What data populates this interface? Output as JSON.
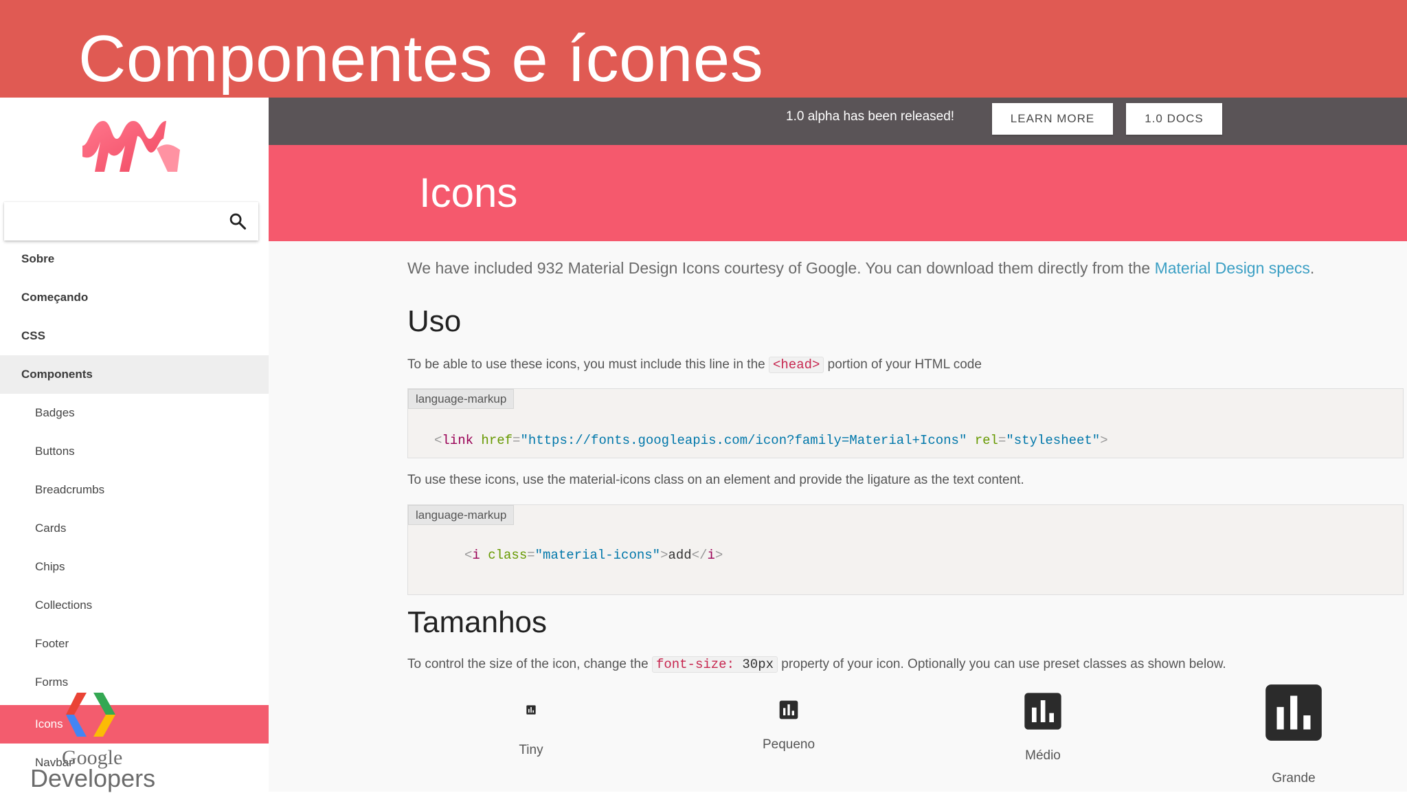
{
  "slide": {
    "title": "Componentes e ícones"
  },
  "sidebar": {
    "logo_icon": "materialize-logo-icon",
    "search": {
      "placeholder": "",
      "icon": "search-icon"
    },
    "items": [
      {
        "label": "Sobre",
        "level": "top"
      },
      {
        "label": "Começando",
        "level": "top"
      },
      {
        "label": "CSS",
        "level": "top"
      },
      {
        "label": "Components",
        "level": "top",
        "expanded": true
      },
      {
        "label": "Badges",
        "level": "sub"
      },
      {
        "label": "Buttons",
        "level": "sub"
      },
      {
        "label": "Breadcrumbs",
        "level": "sub"
      },
      {
        "label": "Cards",
        "level": "sub"
      },
      {
        "label": "Chips",
        "level": "sub"
      },
      {
        "label": "Collections",
        "level": "sub"
      },
      {
        "label": "Footer",
        "level": "sub"
      },
      {
        "label": "Forms",
        "level": "sub"
      },
      {
        "label": "Icons",
        "level": "sub",
        "active": true
      },
      {
        "label": "Navbar",
        "level": "sub"
      }
    ]
  },
  "watermark": {
    "line1": "Google",
    "line2": "Developers",
    "icon": "google-developers-logo-icon"
  },
  "topbar": {
    "release_text": "1.0 alpha has been released!",
    "learn_more": "LEARN MORE",
    "docs": "1.0 DOCS"
  },
  "hero": {
    "title": "Icons"
  },
  "main": {
    "intro": "We have included 932 Material Design Icons courtesy of Google. You can download them directly from the ",
    "intro_link": "Material Design specs",
    "intro_end": ".",
    "uso": {
      "heading": "Uso",
      "para_before": "To be able to use these icons, you must include this line in the ",
      "code": "<head>",
      "para_after": " portion of your HTML code",
      "block1": {
        "tag": "language-markup",
        "open": "<",
        "tagname": "link",
        "attr1": "href",
        "eq1": "=",
        "val1": "\"https://fonts.googleapis.com/icon?family=Material+Icons\"",
        "attr2": "rel",
        "eq2": "=",
        "val2": "\"stylesheet\"",
        "close": ">"
      },
      "para2": "To use these icons, use the material-icons class on an element and provide the ligature as the text content.",
      "block2": {
        "tag": "language-markup",
        "open": "<",
        "tagname": "i",
        "attr": "class",
        "eq": "=",
        "val": "\"material-icons\"",
        "gt": ">",
        "content": "add",
        "end_open": "</",
        "end_tag": "i",
        "end_close": ">"
      }
    },
    "tamanhos": {
      "heading": "Tamanhos",
      "para_before": "To control the size of the icon, change the ",
      "code_prop": "font-size:",
      "code_val": " 30px",
      "para_after": " property of your icon. Optionally you can use preset classes as shown below.",
      "sizes": [
        {
          "label": "Tiny",
          "icon": "insert-chart-icon"
        },
        {
          "label": "Pequeno",
          "icon": "insert-chart-icon"
        },
        {
          "label": "Médio",
          "icon": "insert-chart-icon"
        },
        {
          "label": "Grande",
          "icon": "insert-chart-icon"
        }
      ]
    }
  },
  "colors": {
    "slide_header": "#e05a53",
    "hero": "#f5596d",
    "topbar": "#5a5457",
    "active_nav": "#f35c6e",
    "link": "#3b9fc4"
  }
}
